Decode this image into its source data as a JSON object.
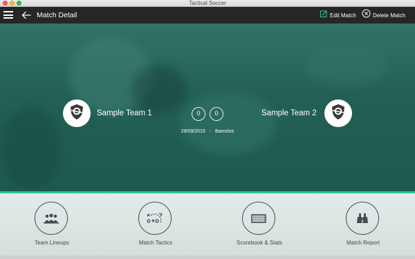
{
  "window": {
    "title": "Tactical Soccer"
  },
  "header": {
    "title": "Match Detail",
    "edit_label": "Edit Match",
    "delete_label": "Delete Match",
    "menu_icon": "hamburger-menu-icon",
    "back_icon": "back-arrow-icon"
  },
  "match": {
    "home_team": "Sample Team 1",
    "away_team": "Sample Team 2",
    "home_score": "0",
    "away_score": "0",
    "date": "29/09/2015",
    "separator": "-",
    "location": "Barcelos"
  },
  "nav": [
    {
      "label": "Team Lineups",
      "icon": "team-lineups-icon"
    },
    {
      "label": "Match Tactics",
      "icon": "match-tactics-icon"
    },
    {
      "label": "Scorebook & Stats",
      "icon": "goal-icon"
    },
    {
      "label": "Match Report",
      "icon": "binoculars-icon"
    }
  ],
  "colors": {
    "appbar": "#262626",
    "hero": "#235f54",
    "accent": "#2cc79a",
    "nav_bg": "#e4ebea"
  }
}
